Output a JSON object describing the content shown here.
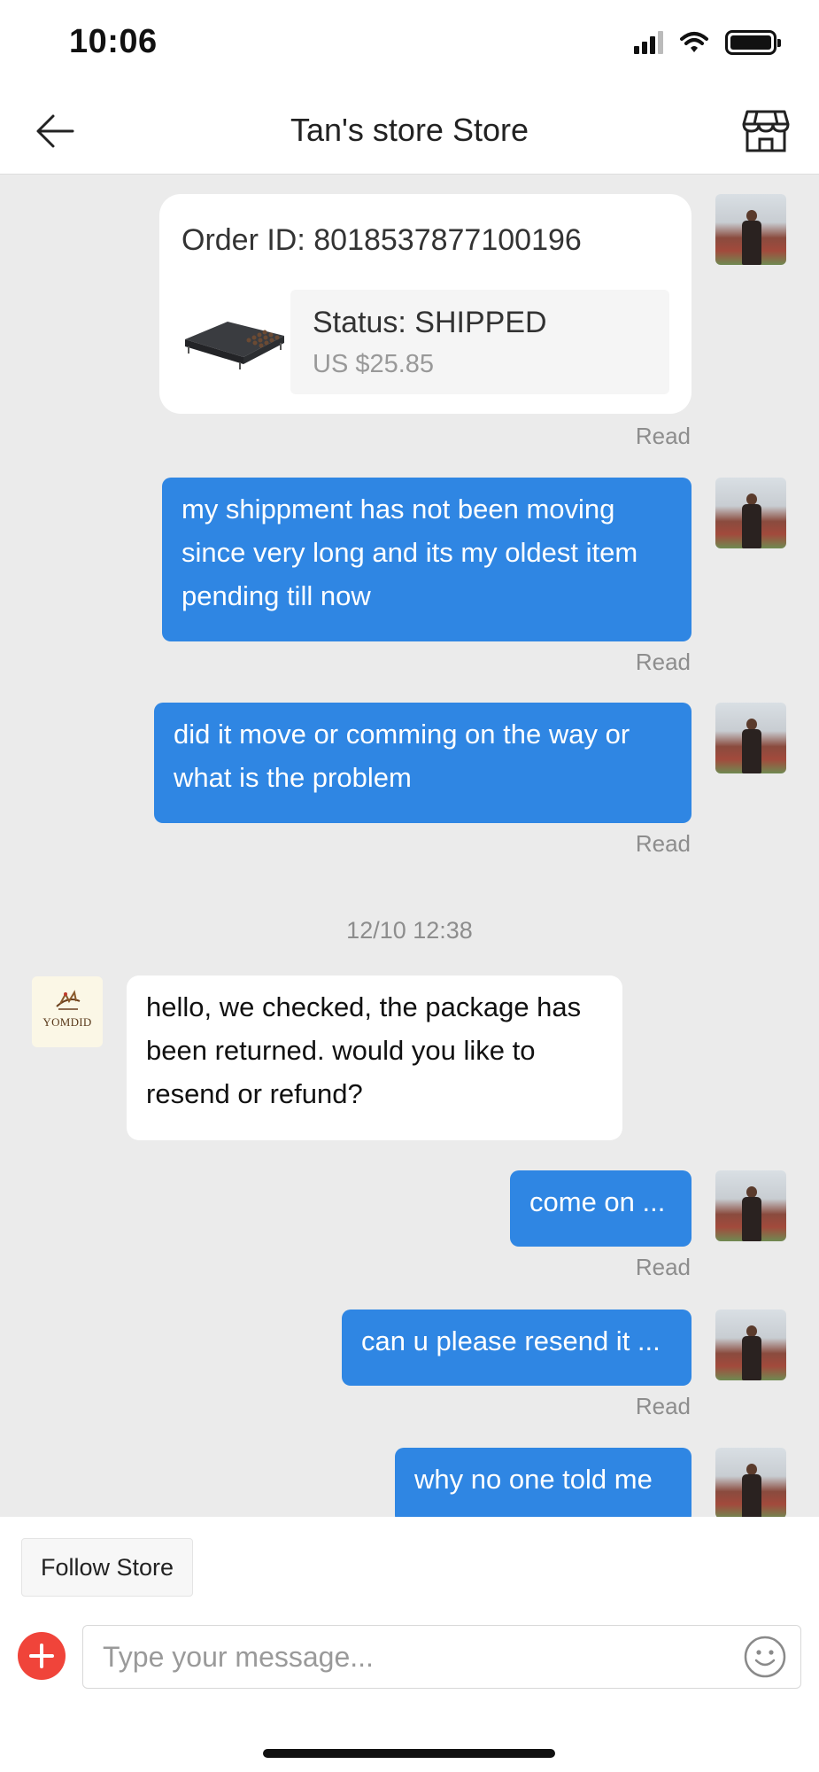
{
  "status_bar": {
    "time": "10:06",
    "icons": [
      "cellular-signal-icon",
      "wifi-icon",
      "battery-icon"
    ]
  },
  "header": {
    "title": "Tan's store Store",
    "back_icon": "arrow-left-icon",
    "store_icon": "storefront-icon"
  },
  "order_card": {
    "order_id": "Order ID: 8018537877100196",
    "status": "Status:  SHIPPED",
    "price": "US $25.85",
    "read": "Read"
  },
  "messages": [
    {
      "sender": "user",
      "text": "my shippment has not been moving since very long and its my oldest item pending till now",
      "read": "Read"
    },
    {
      "sender": "user",
      "text": "did it move or comming on the way or what is the problem",
      "read": "Read"
    },
    {
      "sender": "store",
      "text": "hello, we checked, the package has been returned. would you like to resend or refund?"
    },
    {
      "sender": "user",
      "text": "come on ...",
      "read": "Read"
    },
    {
      "sender": "user",
      "text": "can u please resend it ...",
      "read": "Read"
    },
    {
      "sender": "user",
      "text": "why no one told me"
    }
  ],
  "timestamp": "12/10 12:38",
  "store_logo_text": "YOMDID",
  "footer": {
    "follow_label": "Follow Store",
    "input_placeholder": "Type your message...",
    "input_value": "",
    "plus_icon": "plus-circle-icon",
    "emoji_icon": "smiley-icon"
  },
  "colors": {
    "user_bubble": "#2f86e3",
    "plus_button": "#f0443a",
    "chat_background": "#ebebeb"
  }
}
